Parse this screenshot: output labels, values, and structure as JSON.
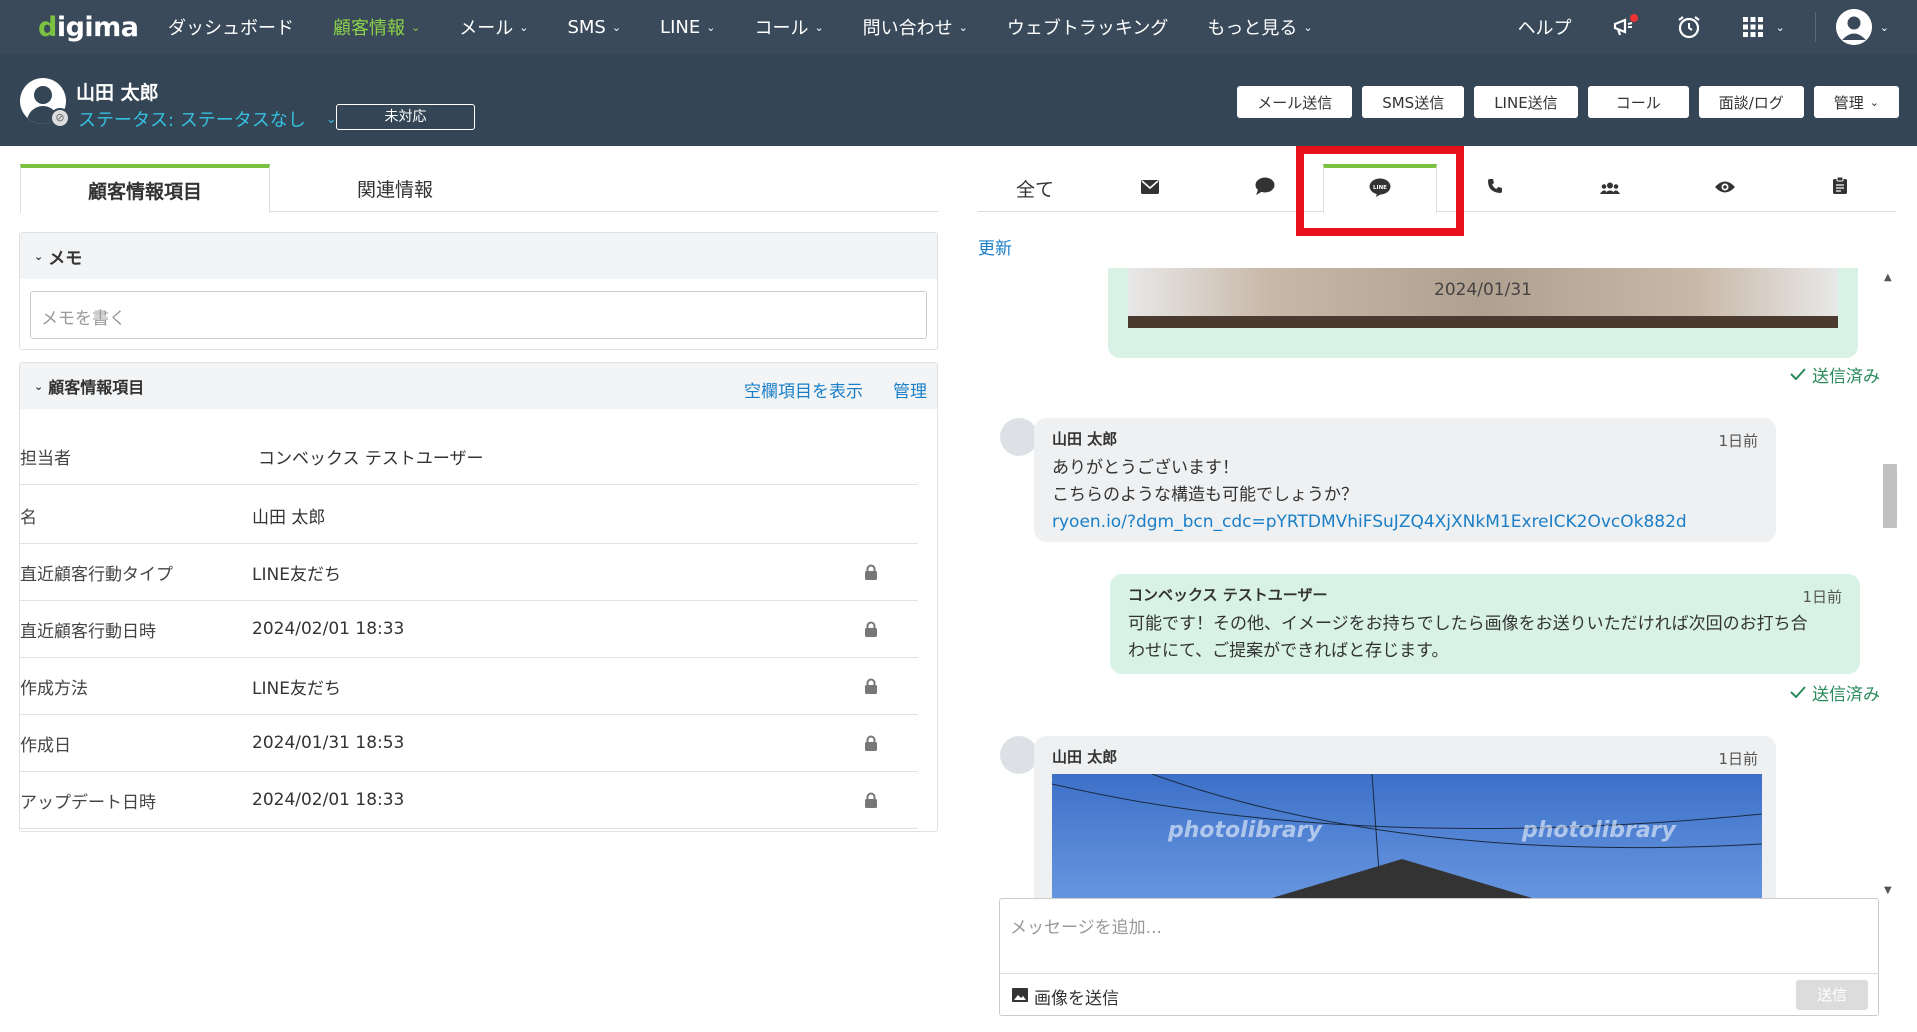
{
  "topnav": {
    "logo": "digima",
    "items": [
      "ダッシュボード",
      "顧客情報",
      "メール",
      "SMS",
      "LINE",
      "コール",
      "問い合わせ",
      "ウェブトラッキング",
      "もっと見る"
    ],
    "help": "ヘルプ"
  },
  "customer": {
    "name": "山田 太郎",
    "status": "ステータス: ステータスなし",
    "status_button": "未対応"
  },
  "actions": [
    "メール送信",
    "SMS送信",
    "LINE送信",
    "コール",
    "面談/ログ",
    "管理"
  ],
  "left_tabs": [
    "顧客情報項目",
    "関連情報"
  ],
  "memo": {
    "title": "メモ",
    "placeholder": "メモを書く"
  },
  "info": {
    "title": "顧客情報項目",
    "show_empty": "空欄項目を表示",
    "manage": "管理",
    "rows": [
      {
        "label": "担当者",
        "value": "コンベックス テストユーザー"
      },
      {
        "label": "名",
        "value": "山田 太郎"
      },
      {
        "label": "直近顧客行動タイプ",
        "value": "LINE友だち"
      },
      {
        "label": "直近顧客行動日時",
        "value": "2024/02/01 18:33"
      },
      {
        "label": "作成方法",
        "value": "LINE友だち"
      },
      {
        "label": "作成日",
        "value": "2024/01/31 18:53"
      },
      {
        "label": "アップデート日時",
        "value": "2024/02/01 18:33"
      }
    ]
  },
  "right_tabs": {
    "all": "全て",
    "line_icon_text": "LINE"
  },
  "refresh": "更新",
  "chat": {
    "top_date": "2024/01/31",
    "sent_label": "送信済み",
    "msg1": {
      "name": "山田 太郎",
      "time": "1日前",
      "line1": "ありがとうございます！",
      "line2": "こちらのような構造も可能でしょうか？",
      "link": "ryoen.io/?dgm_bcn_cdc=pYRTDMVhiFSuJZQ4XjXNkM1ExreICK2OvcOk882d"
    },
    "msg2": {
      "name": "コンベックス テストユーザー",
      "time": "1日前",
      "line1": "可能です！その他、イメージをお持ちでしたら画像をお送りいただければ次回のお打ち合",
      "line2": "わせにて、ご提案ができればと存じます。"
    },
    "msg3": {
      "name": "山田 太郎",
      "time": "1日前",
      "watermark": "photolibrary"
    }
  },
  "composer": {
    "placeholder": "メッセージを追加...",
    "image_send": "画像を送信",
    "send": "送信"
  }
}
